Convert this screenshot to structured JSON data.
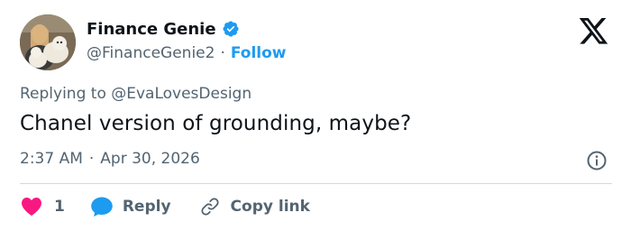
{
  "author": {
    "display_name": "Finance Genie",
    "handle": "@FinanceGenie2",
    "separator": "·",
    "follow_label": "Follow",
    "verified_icon": "verified-badge-icon",
    "avatar_icon": "avatar"
  },
  "reply_context": {
    "prefix": "Replying to",
    "mention": "@EvaLovesDesign"
  },
  "tweet": {
    "text": "Chanel version of grounding, maybe?",
    "time": "2:37 AM",
    "separator": "·",
    "date": "Apr 30, 2026"
  },
  "actions": {
    "like_count": "1",
    "reply_label": "Reply",
    "copy_label": "Copy link"
  },
  "colors": {
    "accent": "#1d9bf0",
    "like": "#f91880",
    "text": "#0f1419",
    "muted": "#536471",
    "divider": "#cfd9de"
  },
  "icons": {
    "logo": "x-logo-icon",
    "info": "info-icon",
    "like": "heart-icon",
    "reply": "speech-bubble-icon",
    "copy": "link-icon"
  }
}
